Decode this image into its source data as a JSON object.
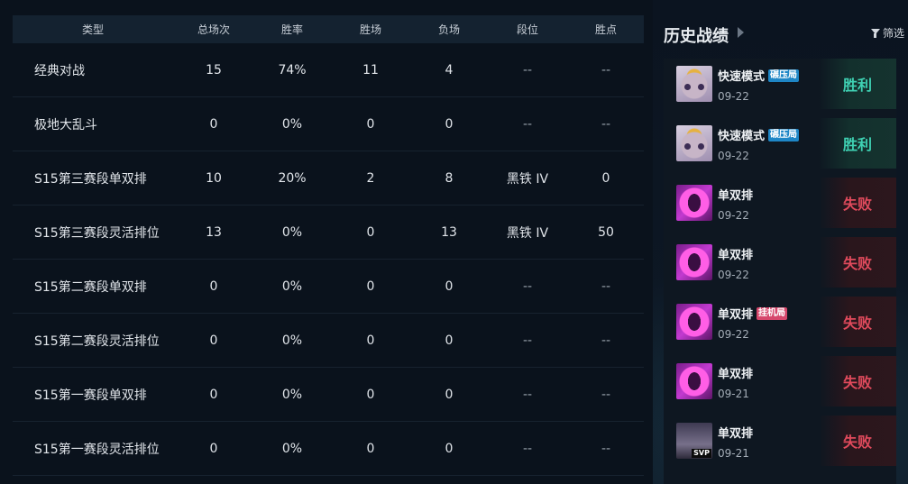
{
  "stats_table": {
    "headers": [
      "类型",
      "总场次",
      "胜率",
      "胜场",
      "负场",
      "段位",
      "胜点"
    ],
    "rows": [
      [
        "经典对战",
        "15",
        "74%",
        "11",
        "4",
        "--",
        "--"
      ],
      [
        "极地大乱斗",
        "0",
        "0%",
        "0",
        "0",
        "--",
        "--"
      ],
      [
        "S15第三赛段单双排",
        "10",
        "20%",
        "2",
        "8",
        "黑铁 IV",
        "0"
      ],
      [
        "S15第三赛段灵活排位",
        "13",
        "0%",
        "0",
        "13",
        "黑铁 IV",
        "50"
      ],
      [
        "S15第二赛段单双排",
        "0",
        "0%",
        "0",
        "0",
        "--",
        "--"
      ],
      [
        "S15第二赛段灵活排位",
        "0",
        "0%",
        "0",
        "0",
        "--",
        "--"
      ],
      [
        "S15第一赛段单双排",
        "0",
        "0%",
        "0",
        "0",
        "--",
        "--"
      ],
      [
        "S15第一赛段灵活排位",
        "0",
        "0%",
        "0",
        "0",
        "--",
        "--"
      ]
    ]
  },
  "history": {
    "title": "历史战绩",
    "filter_label": "筛选",
    "matches": [
      {
        "mode": "快速模式",
        "tag": "碾压局",
        "tag_color": "blue",
        "date": "09-22",
        "result": "胜利",
        "outcome": "win",
        "avatar": "cat"
      },
      {
        "mode": "快速模式",
        "tag": "碾压局",
        "tag_color": "blue",
        "date": "09-22",
        "result": "胜利",
        "outcome": "win",
        "avatar": "cat"
      },
      {
        "mode": "单双排",
        "tag": "",
        "tag_color": "",
        "date": "09-22",
        "result": "失败",
        "outcome": "loss",
        "avatar": "gem"
      },
      {
        "mode": "单双排",
        "tag": "",
        "tag_color": "",
        "date": "09-22",
        "result": "失败",
        "outcome": "loss",
        "avatar": "gem"
      },
      {
        "mode": "单双排",
        "tag": "挂机局",
        "tag_color": "pink",
        "date": "09-22",
        "result": "失败",
        "outcome": "loss",
        "avatar": "gem"
      },
      {
        "mode": "单双排",
        "tag": "",
        "tag_color": "",
        "date": "09-21",
        "result": "失败",
        "outcome": "loss",
        "avatar": "gem"
      },
      {
        "mode": "单双排",
        "tag": "",
        "tag_color": "",
        "date": "09-21",
        "result": "失败",
        "outcome": "loss",
        "avatar": "bot",
        "badge": "SVP"
      }
    ]
  },
  "colors": {
    "win": "#3fd1b3",
    "loss": "#e04a5c",
    "tag_blue": "#1e86c6",
    "tag_pink": "#d6476c"
  }
}
